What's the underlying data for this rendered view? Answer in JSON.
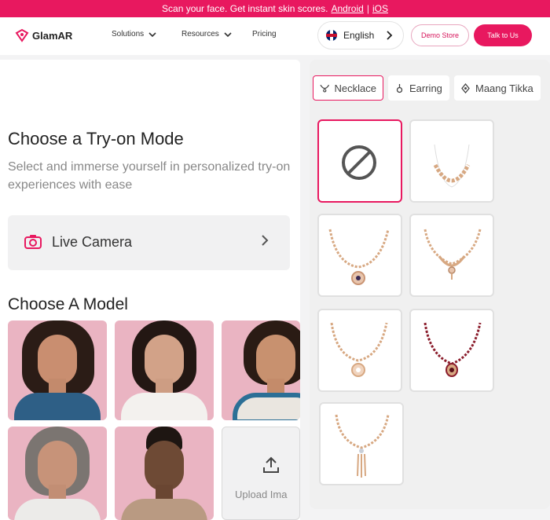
{
  "banner": {
    "text": "Scan your face. Get instant skin scores.",
    "android": "Android",
    "sep": "|",
    "ios": "iOS"
  },
  "nav": {
    "brand": "GlamAR",
    "links": [
      "Solutions",
      "Resources",
      "Pricing"
    ],
    "language": "English",
    "demo": "Demo Store",
    "talk": "Talk to Us"
  },
  "tryon": {
    "title": "Choose a Try-on Mode",
    "subtitle": "Select and immerse yourself in personalized try-on experiences with ease",
    "live_camera": "Live Camera",
    "models_title": "Choose A Model",
    "upload": "Upload Ima"
  },
  "categories": [
    {
      "label": "Necklace",
      "icon": "necklace-icon",
      "active": true
    },
    {
      "label": "Earring",
      "icon": "earring-icon",
      "active": false
    },
    {
      "label": "Maang Tikka",
      "icon": "maang-tikka-icon",
      "active": false
    }
  ],
  "colors": {
    "accent": "#e8185f",
    "panel": "#f0f0f0",
    "gold": "#d7a882",
    "ruby": "#8b1d2c"
  }
}
